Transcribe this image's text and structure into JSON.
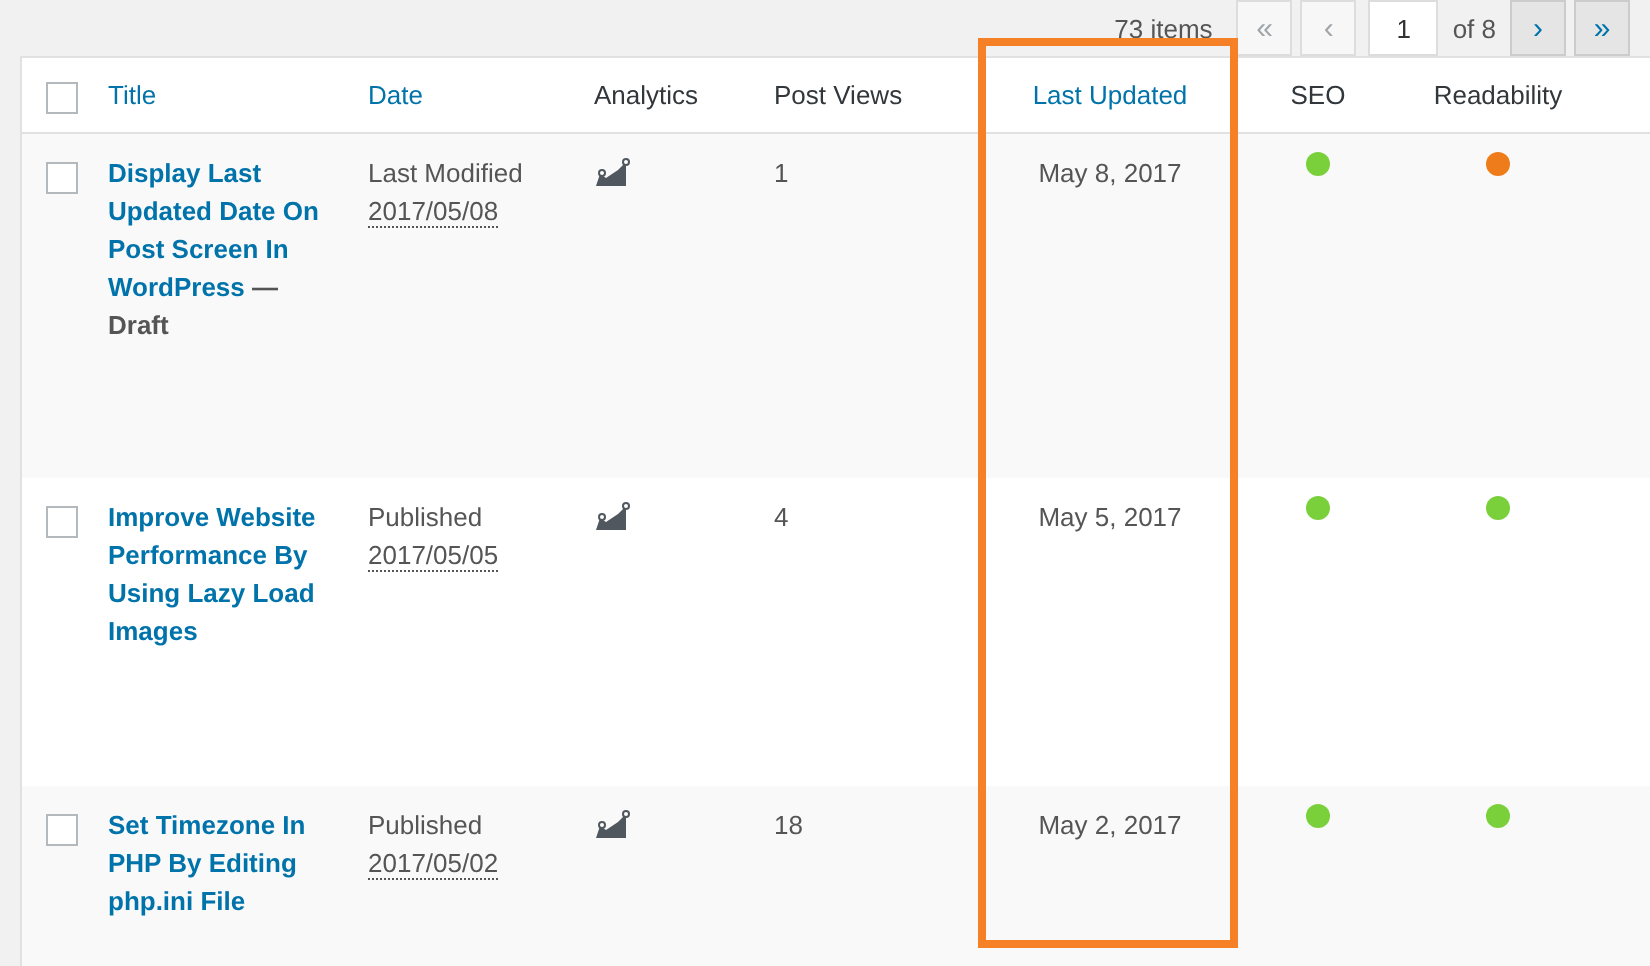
{
  "pagination": {
    "count": "73 items",
    "buttons": [
      {
        "label": "«",
        "disabled": true
      },
      {
        "label": "‹",
        "disabled": true
      }
    ],
    "page": "1",
    "total": "of 8",
    "next_buttons": [
      {
        "label": "›",
        "disabled": false
      },
      {
        "label": "»",
        "disabled": false
      }
    ]
  },
  "table": {
    "select_all_checked": false,
    "columns": [
      {
        "label": "Title",
        "sortable": true
      },
      {
        "label": "Date",
        "sortable": true
      },
      {
        "label": "Analytics",
        "sortable": false
      },
      {
        "label": "Post Views",
        "sortable": false
      },
      {
        "label": "Last Updated",
        "sortable": true
      },
      {
        "label": "SEO",
        "sortable": false
      },
      {
        "label": "Readability",
        "sortable": false
      }
    ],
    "rows": [
      {
        "checked": false,
        "title": "Display Last Updated Date On Post Screen In WordPress",
        "post_state": "— Draft",
        "date_status": "Last Modified",
        "date": "2017/05/08",
        "views": "1",
        "last_updated": "May 8, 2017",
        "scores": [
          {
            "color": "#7ad03a"
          },
          {
            "color": "#ee7c1b"
          }
        ]
      },
      {
        "checked": false,
        "title": "Improve Website Performance By Using Lazy Load Images",
        "date_status": "Published",
        "date": "2017/05/05",
        "views": "4",
        "last_updated": "May 5, 2017",
        "scores": [
          {
            "color": "#7ad03a"
          },
          {
            "color": "#7ad03a"
          }
        ]
      },
      {
        "checked": false,
        "title": "Set Timezone In PHP By Editing php.ini File",
        "date_status": "Published",
        "date": "2017/05/02",
        "views": "18",
        "last_updated": "May 2, 2017",
        "scores": [
          {
            "color": "#7ad03a"
          },
          {
            "color": "#7ad03a"
          }
        ]
      }
    ]
  }
}
